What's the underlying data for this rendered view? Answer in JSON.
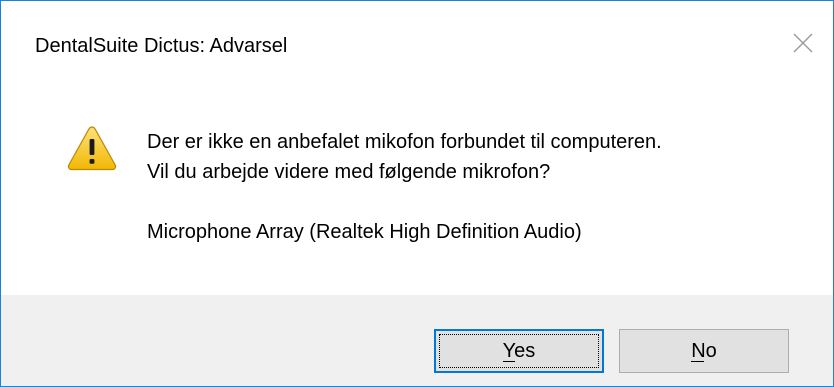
{
  "window": {
    "title": "DentalSuite Dictus: Advarsel"
  },
  "message": {
    "line1": "Der er ikke en anbefalet mikofon forbundet til computeren.",
    "line2": "Vil du arbejde videre med følgende mikrofon?",
    "device": "Microphone Array (Realtek High Definition Audio)",
    "icon": "warning-icon"
  },
  "buttons": {
    "yes_label": "Yes",
    "no_label": "No"
  },
  "colors": {
    "border": "#1883d7",
    "footer": "#f0f0f0",
    "button": "#e1e1e1",
    "default_button_border": "#0078d7",
    "warning_fill": "#f7c522"
  }
}
